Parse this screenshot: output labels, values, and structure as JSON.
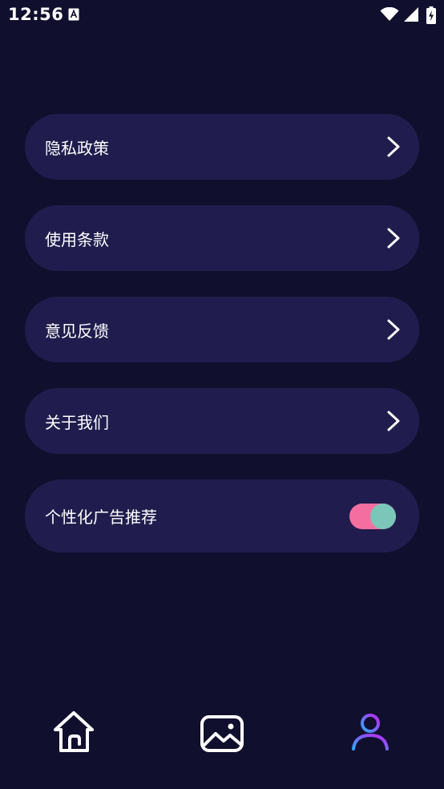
{
  "status_bar": {
    "time": "12:56",
    "icons": [
      "a-notification-icon",
      "wifi-icon",
      "signal-icon",
      "battery-charging-icon"
    ]
  },
  "menu": {
    "items": [
      {
        "label": "隐私政策",
        "icon": "chevron-right-icon"
      },
      {
        "label": "使用条款",
        "icon": "chevron-right-icon"
      },
      {
        "label": "意见反馈",
        "icon": "chevron-right-icon"
      },
      {
        "label": "关于我们",
        "icon": "chevron-right-icon"
      }
    ],
    "toggle_item": {
      "label": "个性化广告推荐",
      "enabled": true
    }
  },
  "bottom_nav": {
    "items": [
      {
        "icon": "home-icon",
        "active": false
      },
      {
        "icon": "gallery-icon",
        "active": false
      },
      {
        "icon": "profile-icon",
        "active": true
      }
    ]
  },
  "colors": {
    "background": "#110f2e",
    "card": "#201d4e",
    "toggle_track": "#f46fa0",
    "toggle_knob": "#7bc6b8",
    "active_gradient_start": "#2fa8ff",
    "active_gradient_end": "#c026ff"
  }
}
